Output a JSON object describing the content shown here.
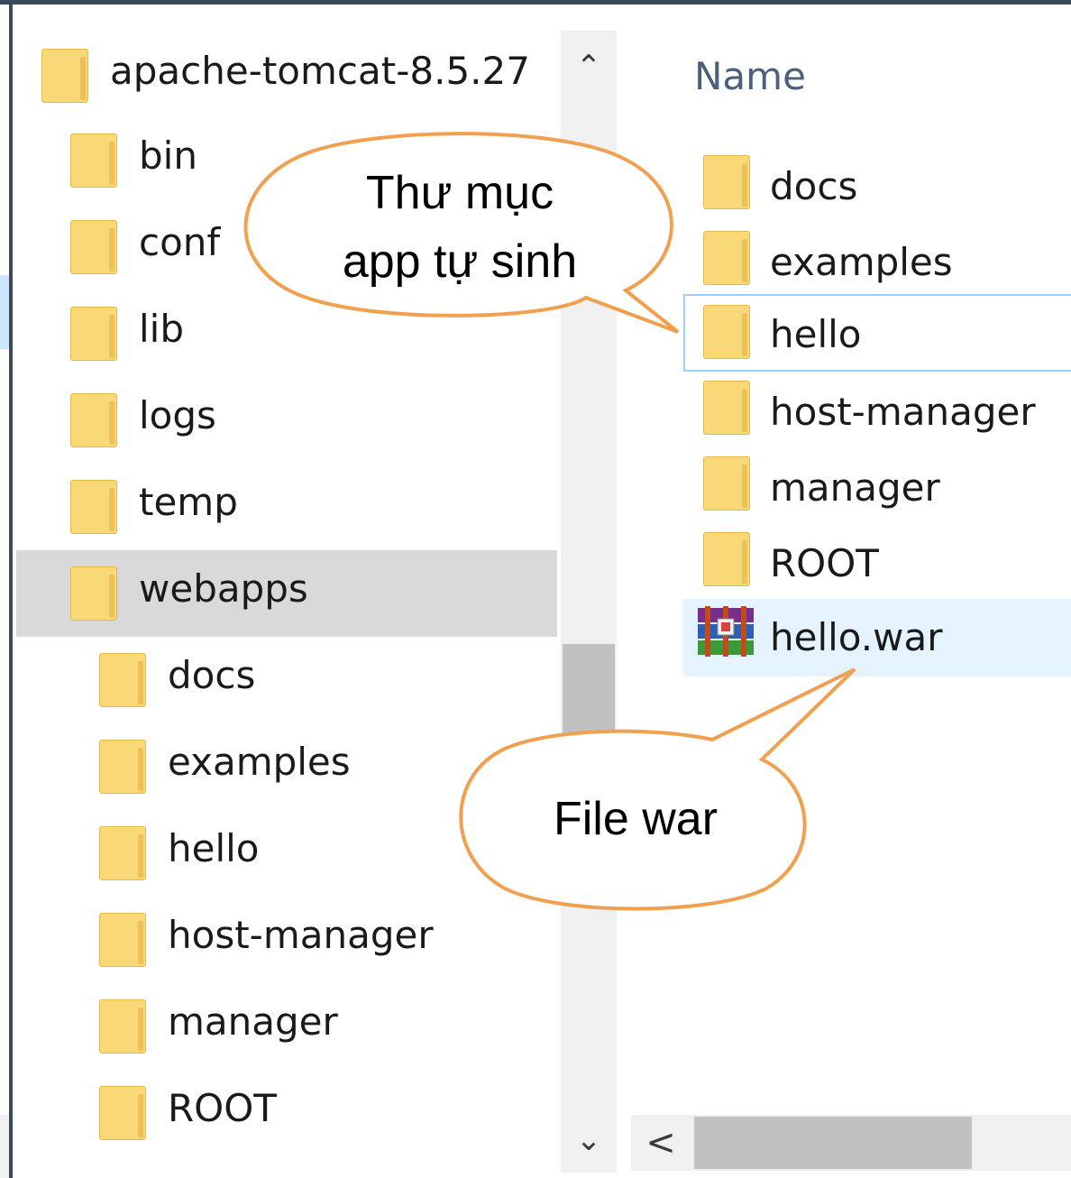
{
  "tree": {
    "root": "apache-tomcat-8.5.27",
    "items": [
      {
        "label": "bin"
      },
      {
        "label": "conf"
      },
      {
        "label": "lib"
      },
      {
        "label": "logs"
      },
      {
        "label": "temp"
      },
      {
        "label": "webapps",
        "selected": true
      }
    ],
    "webapps_children": [
      {
        "label": "docs"
      },
      {
        "label": "examples"
      },
      {
        "label": "hello"
      },
      {
        "label": "host-manager"
      },
      {
        "label": "manager"
      },
      {
        "label": "ROOT"
      }
    ]
  },
  "content": {
    "column_header": "Name",
    "files": [
      {
        "label": "docs",
        "icon": "folder-icon"
      },
      {
        "label": "examples",
        "icon": "folder-icon"
      },
      {
        "label": "hello",
        "icon": "folder-icon",
        "state": "focused"
      },
      {
        "label": "host-manager",
        "icon": "folder-icon"
      },
      {
        "label": "manager",
        "icon": "folder-icon"
      },
      {
        "label": "ROOT",
        "icon": "folder-icon"
      },
      {
        "label": "hello.war",
        "icon": "winrar-archive-icon",
        "state": "hovered"
      }
    ]
  },
  "callouts": {
    "app_folder": {
      "line1": "Thư mục",
      "line2": "app tự sinh"
    },
    "war_file": {
      "text": "File war"
    }
  },
  "colors": {
    "folder_fill": "#f9d977",
    "selection_gray": "#d9d9d9",
    "hover_blue": "#e5f3ff",
    "focus_border": "#99d1ff",
    "callout_stroke": "#f0a050",
    "header_text": "#4c607a"
  }
}
